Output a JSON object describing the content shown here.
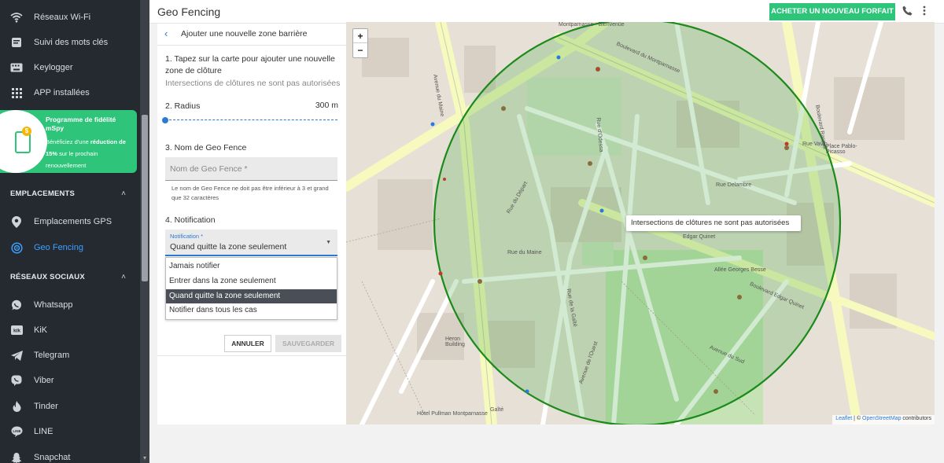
{
  "sidebar": {
    "top_items": [
      {
        "label": "Réseaux Wi-Fi",
        "icon": "wifi-icon"
      },
      {
        "label": "Suivi des mots clés",
        "icon": "keyword-icon"
      },
      {
        "label": "Keylogger",
        "icon": "keyboard-icon"
      },
      {
        "label": "APP installées",
        "icon": "apps-grid-icon"
      }
    ],
    "promo": {
      "title": "Programme de fidélité mSpy",
      "desc_pre": "Bénéficiez d'une ",
      "desc_bold1": "réduction de 15%",
      "desc_post": " sur le prochain renouvellement",
      "coin": "$"
    },
    "sections": {
      "emplacements": "EMPLACEMENTS",
      "social": "RÉSEAUX SOCIAUX"
    },
    "location_items": [
      {
        "label": "Emplacements GPS",
        "icon": "location-pin-icon"
      },
      {
        "label": "Geo Fencing",
        "icon": "geofence-icon"
      }
    ],
    "social_items": [
      {
        "label": "Whatsapp",
        "icon": "whatsapp-icon"
      },
      {
        "label": "KiK",
        "icon": "kik-icon"
      },
      {
        "label": "Telegram",
        "icon": "telegram-icon"
      },
      {
        "label": "Viber",
        "icon": "viber-icon"
      },
      {
        "label": "Tinder",
        "icon": "tinder-icon"
      },
      {
        "label": "LINE",
        "icon": "line-icon"
      },
      {
        "label": "Snapchat",
        "icon": "snapchat-icon"
      }
    ],
    "active": "Geo Fencing",
    "accent": "#3da0ff"
  },
  "header": {
    "title": "Geo Fencing",
    "buy_label": "ACHETER UN NOUVEAU FORFAIT",
    "brand_green": "#2ec47a"
  },
  "panel": {
    "title": "Ajouter une nouvelle zone barrière",
    "step1": "1. Tapez sur la carte pour ajouter une nouvelle zone de clôture",
    "step1_hint": "Intersections de clôtures ne sont pas autorisées",
    "step2": "2. Radius",
    "radius_value": "300 m",
    "step3": "3. Nom de Geo Fence",
    "name_placeholder": "Nom de Geo Fence *",
    "name_help": "Le nom de Geo Fence ne doit pas être inférieur à 3 et grand que 32 caractères",
    "step4": "4. Notification",
    "notif_label": "Notification *",
    "notif_value": "Quand quitte la zone seulement",
    "options": [
      "Jamais notifier",
      "Entrer dans la zone seulement",
      "Quand quitte la zone seulement",
      "Notifier dans tous les cas"
    ],
    "cancel": "ANNULER",
    "save": "SAUVEGARDER"
  },
  "map": {
    "tooltip": "Intersections de clôtures ne sont pas autorisées",
    "zoom_in": "+",
    "zoom_out": "−",
    "attribution_leaflet": "Leaflet",
    "attribution_sep": " | © ",
    "attribution_osm": "OpenStreetMap",
    "attribution_post": " contributors",
    "fence_color": "#1a8a1a",
    "labels": {
      "montparnasse_bienvenue": "Montparnasse - Bienvenüe",
      "bd_montparnasse": "Boulevard du Montparnasse",
      "rue_depart": "Rue du Départ",
      "rue_odessa": "Rue d'Odessa",
      "rue_delambre": "Rue Delambre",
      "av_maine": "Avenue du Maine",
      "rue_maine": "Rue du Maine",
      "bd_edgar_quinet": "Boulevard Edgar Quinet",
      "allee_georges_besse": "Allée Georges Besse",
      "rue_gaite": "Rue de la Gaîté",
      "av_ouest": "Avenue de l'Ouest",
      "av_sud": "Avenue du Sud",
      "bd_raspail": "Boulevard Raspail",
      "rue_vavin": "Rue Vavin",
      "place_picasso": "Place Pablo-Picasso",
      "heron_building": "Heron Building",
      "hotel_pullman": "Hôtel Pullman Montparnasse",
      "gaite": "Gaîté",
      "edgar_quinet_label": "Edgar Quinet"
    }
  }
}
